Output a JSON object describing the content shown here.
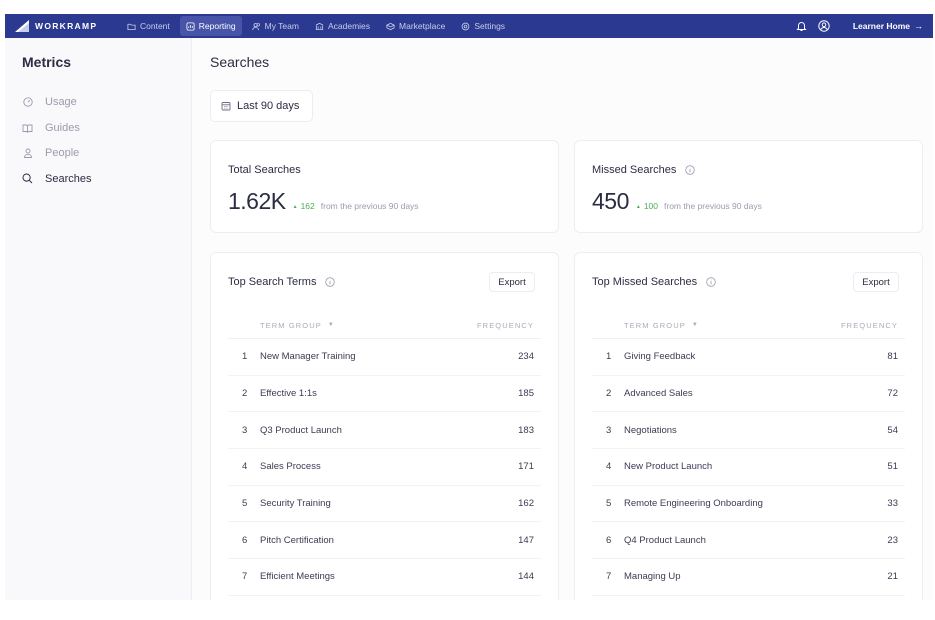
{
  "topnav": {
    "brand": "WORKRAMP",
    "items": [
      {
        "label": "Content",
        "icon": "folder-icon",
        "active": false
      },
      {
        "label": "Reporting",
        "icon": "report-icon",
        "active": true
      },
      {
        "label": "My Team",
        "icon": "team-icon",
        "active": false
      },
      {
        "label": "Academies",
        "icon": "academy-icon",
        "active": false
      },
      {
        "label": "Marketplace",
        "icon": "marketplace-icon",
        "active": false
      },
      {
        "label": "Settings",
        "icon": "gear-icon",
        "active": false
      }
    ],
    "learner_home": "Learner Home",
    "arrow": "→"
  },
  "sidebar": {
    "title": "Metrics",
    "items": [
      {
        "label": "Usage",
        "icon": "gauge-icon",
        "active": false
      },
      {
        "label": "Guides",
        "icon": "book-icon",
        "active": false
      },
      {
        "label": "People",
        "icon": "person-icon",
        "active": false
      },
      {
        "label": "Searches",
        "icon": "search-icon",
        "active": true
      }
    ]
  },
  "main": {
    "title": "Searches",
    "date_filter": "Last 90 days",
    "stats": {
      "total": {
        "label": "Total Searches",
        "value": "1.62K",
        "delta": "162",
        "suffix": "from the previous 90 days"
      },
      "missed": {
        "label": "Missed Searches",
        "value": "450",
        "delta": "100",
        "suffix": "from the previous 90 days"
      }
    },
    "top_terms": {
      "title": "Top Search Terms",
      "export": "Export",
      "col_term": "TERM GROUP",
      "col_freq": "FREQUENCY",
      "rows": [
        {
          "rank": "1",
          "term": "New Manager Training",
          "freq": "234"
        },
        {
          "rank": "2",
          "term": "Effective 1:1s",
          "freq": "185"
        },
        {
          "rank": "3",
          "term": "Q3 Product Launch",
          "freq": "183"
        },
        {
          "rank": "4",
          "term": "Sales Process",
          "freq": "171"
        },
        {
          "rank": "5",
          "term": "Security Training",
          "freq": "162"
        },
        {
          "rank": "6",
          "term": "Pitch Certification",
          "freq": "147"
        },
        {
          "rank": "7",
          "term": "Efficient Meetings",
          "freq": "144"
        }
      ]
    },
    "top_missed": {
      "title": "Top Missed Searches",
      "export": "Export",
      "col_term": "TERM GROUP",
      "col_freq": "FREQUENCY",
      "rows": [
        {
          "rank": "1",
          "term": "Giving Feedback",
          "freq": "81"
        },
        {
          "rank": "2",
          "term": "Advanced Sales",
          "freq": "72"
        },
        {
          "rank": "3",
          "term": "Negotiations",
          "freq": "54"
        },
        {
          "rank": "4",
          "term": "New Product Launch",
          "freq": "51"
        },
        {
          "rank": "5",
          "term": "Remote Engineering Onboarding",
          "freq": "33"
        },
        {
          "rank": "6",
          "term": "Q4 Product Launch",
          "freq": "23"
        },
        {
          "rank": "7",
          "term": "Managing Up",
          "freq": "21"
        }
      ]
    }
  },
  "colors": {
    "nav_bg": "#2b3990",
    "nav_active": "#4754a8",
    "delta_green": "#4caf50",
    "text_primary": "#2b2d42",
    "text_muted": "#9a9cad"
  }
}
